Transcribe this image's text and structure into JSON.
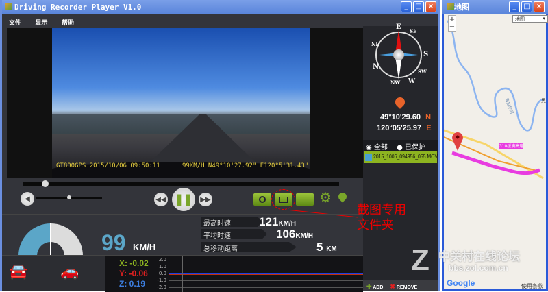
{
  "main_window": {
    "title": "Driving Recorder Player V1.0",
    "menu": [
      "文件",
      "显示",
      "帮助"
    ]
  },
  "video": {
    "overlay_left": "GT800GPS 2015/10/06 09:50:11",
    "overlay_right": "99KM/H N49°10'27.92\" E120°5'31.43\""
  },
  "playback": {
    "progress": 0.07,
    "volume": 0.5
  },
  "compass": {
    "labels": [
      "E",
      "SE",
      "S",
      "SW",
      "W",
      "NW",
      "N",
      "NE"
    ]
  },
  "location": {
    "lat": "49°10'29.60",
    "lat_dir": "N",
    "lon": "120°05'25.97",
    "lon_dir": "E"
  },
  "filter": {
    "all_label": "全部",
    "protected_label": "已保护",
    "selected": "all"
  },
  "files": [
    {
      "name": "2015_1006_094956_055.MOV"
    }
  ],
  "list_actions": {
    "add": "ADD",
    "remove": "REMOVE"
  },
  "speed": {
    "value": "99",
    "unit": "KM/H",
    "gauge_fraction": 0.5
  },
  "stats": [
    {
      "label": "最高时速",
      "value": "121",
      "unit": "KM/H"
    },
    {
      "label": "平均时速",
      "value": "106",
      "unit": "KM/H"
    },
    {
      "label": "总移动距离",
      "value": "5",
      "unit": "KM"
    }
  ],
  "gsensor": {
    "x_label": "X:",
    "x": "-0.02",
    "y_label": "Y:",
    "y": "-0.06",
    "z_label": "Z:",
    "z": "0.19",
    "ticks": [
      "2.0",
      "1.0",
      "0.0",
      "-1.0",
      "-2.0"
    ]
  },
  "annotation": {
    "line1": "截图专用",
    "line2": "文件夹"
  },
  "map_window": {
    "title": "地图",
    "map_type": "地图",
    "zoom_in": "+",
    "zoom_out": "−",
    "road_label": "G10绥满高速",
    "river_label": "海拉尔河",
    "edge_label": "黑",
    "logo": "Google",
    "terms": "使用条款"
  },
  "watermark": {
    "cn": "中关村在线论坛",
    "url": "bbs.zol.com.cn"
  },
  "colors": {
    "accent_green": "#7aa62a",
    "orange": "#e8632a",
    "route": "#e83ce0"
  }
}
